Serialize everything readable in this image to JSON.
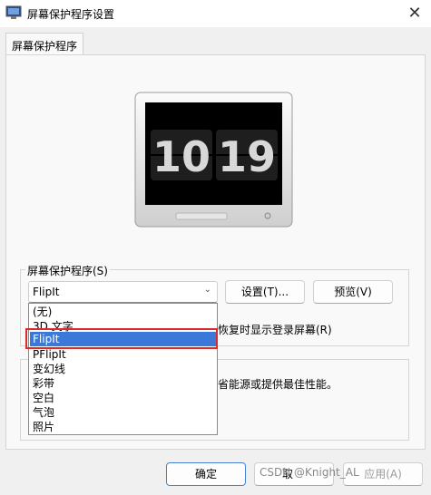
{
  "window": {
    "title": "屏幕保护程序设置",
    "close_glyph": "✕"
  },
  "tab": {
    "label": "屏幕保护程序"
  },
  "preview_clock": {
    "d1": "1",
    "d2": "0",
    "d3": "1",
    "d4": "9"
  },
  "screensaver": {
    "group_label": "屏幕保护程序(S)",
    "selected": "FlipIt",
    "settings_button": "设置(T)...",
    "preview_button": "预览(V)",
    "resume_text": "恢复时显示登录屏幕(R)",
    "options": [
      "(无)",
      "3D 文字",
      "FlipIt",
      "PFlipIt",
      "变幻线",
      "彩带",
      "空白",
      "气泡",
      "照片"
    ]
  },
  "power": {
    "text": "省能源或提供最佳性能。"
  },
  "footer": {
    "ok_button": "确定",
    "cancel_partial": "取",
    "apply_partial": "应用(A)"
  },
  "watermark": "CSDN @Knight_AL",
  "colors": {
    "selection": "#3c78d8",
    "highlight_border": "#d92b2b"
  }
}
